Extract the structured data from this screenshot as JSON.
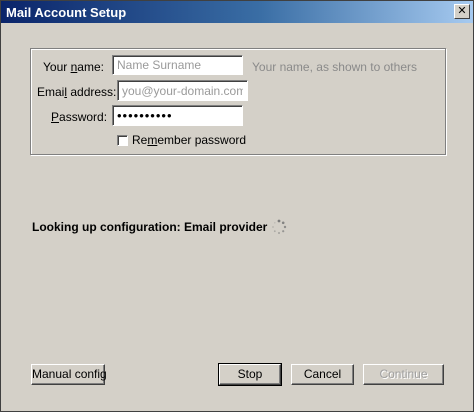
{
  "window": {
    "title": "Mail Account Setup",
    "close_glyph": "✕"
  },
  "form": {
    "name": {
      "label_prefix": "Your ",
      "label_accel": "n",
      "label_suffix": "ame:",
      "placeholder": "Name Surname",
      "value": "",
      "hint": "Your name, as shown to others"
    },
    "email": {
      "label_prefix": "Emai",
      "label_accel": "l",
      "label_suffix": " address:",
      "placeholder": "you@your-domain.com",
      "value": ""
    },
    "password": {
      "label_prefix": "",
      "label_accel": "P",
      "label_suffix": "assword:",
      "value": "••••••••••"
    },
    "remember": {
      "label_prefix": "Re",
      "label_accel": "m",
      "label_suffix": "ember password",
      "checked": false
    }
  },
  "status": {
    "text": "Looking up configuration: Email provider"
  },
  "buttons": {
    "manual_config": "Manual config",
    "stop": "Stop",
    "cancel": "Cancel",
    "continue": "Continue"
  },
  "colors": {
    "dialog_bg": "#d4d0c8",
    "titlebar_start": "#0a246a",
    "titlebar_end": "#a6caf0"
  }
}
